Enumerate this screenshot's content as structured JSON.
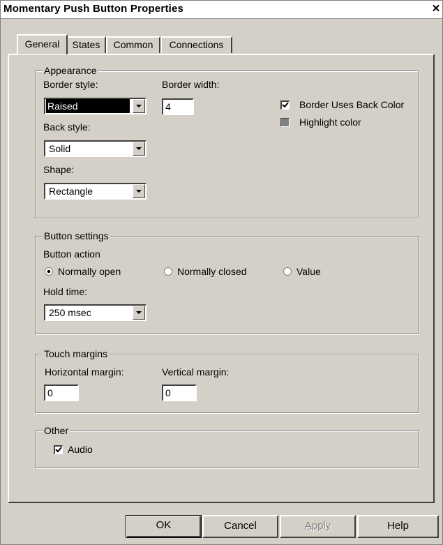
{
  "window": {
    "title": "Momentary Push Button Properties",
    "close_glyph": "✕"
  },
  "tabs": [
    {
      "label": "General",
      "active": true
    },
    {
      "label": "States",
      "active": false
    },
    {
      "label": "Common",
      "active": false
    },
    {
      "label": "Connections",
      "active": false
    }
  ],
  "appearance": {
    "legend": "Appearance",
    "border_style_label": "Border style:",
    "border_style_value": "Raised",
    "border_width_label": "Border width:",
    "border_width_value": "4",
    "back_style_label": "Back style:",
    "back_style_value": "Solid",
    "shape_label": "Shape:",
    "shape_value": "Rectangle",
    "border_uses_back_color_label": "Border Uses Back Color",
    "border_uses_back_color_checked": true,
    "highlight_color_label": "Highlight color",
    "highlight_color": "#808080"
  },
  "button_settings": {
    "legend": "Button settings",
    "action_label": "Button action",
    "options": [
      {
        "label": "Normally open",
        "selected": true
      },
      {
        "label": "Normally closed",
        "selected": false
      },
      {
        "label": "Value",
        "selected": false
      }
    ],
    "hold_time_label": "Hold time:",
    "hold_time_value": "250 msec"
  },
  "touch_margins": {
    "legend": "Touch margins",
    "horizontal_label": "Horizontal margin:",
    "horizontal_value": "0",
    "vertical_label": "Vertical margin:",
    "vertical_value": "0"
  },
  "other": {
    "legend": "Other",
    "audio_label": "Audio",
    "audio_checked": true
  },
  "footer": {
    "ok_label": "OK",
    "cancel_label": "Cancel",
    "apply_label": "Apply",
    "help_label": "Help"
  }
}
